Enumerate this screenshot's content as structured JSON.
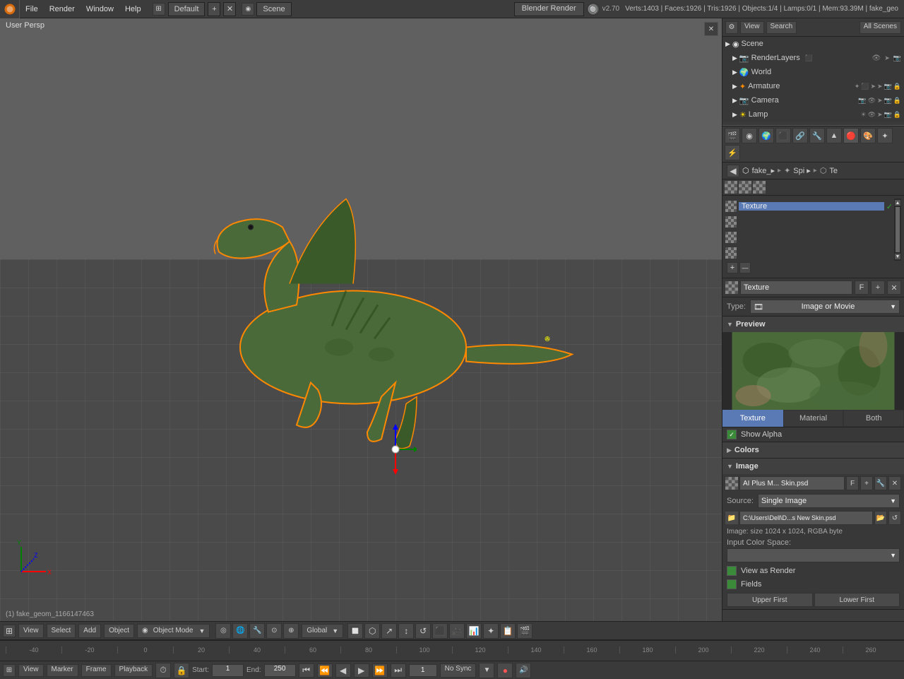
{
  "app": {
    "title": "Blender",
    "version": "v2.70",
    "stats": "Verts:1403 | Faces:1926 | Tris:1926 | Objects:1/4 | Lamps:0/1 | Mem:93.39M | fake_geo",
    "workspace": "Default",
    "scene": "Scene",
    "engine": "Blender Render"
  },
  "menu": {
    "items": [
      "File",
      "Render",
      "Window",
      "Help"
    ]
  },
  "viewport": {
    "mode": "User Persp",
    "object_mode": "Object Mode",
    "transform": "Global",
    "status": "(1) fake_geom_1166147463"
  },
  "outliner": {
    "title": "View",
    "search_label": "Search",
    "all_scenes": "All Scenes",
    "items": [
      {
        "label": "Scene",
        "type": "scene",
        "indent": 0
      },
      {
        "label": "RenderLayers",
        "type": "renderlayers",
        "indent": 1
      },
      {
        "label": "World",
        "type": "world",
        "indent": 1
      },
      {
        "label": "Armature",
        "type": "armature",
        "indent": 1
      },
      {
        "label": "Camera",
        "type": "camera",
        "indent": 1
      },
      {
        "label": "Lamp",
        "type": "lamp",
        "indent": 1
      }
    ]
  },
  "properties": {
    "breadcrumb": {
      "part1": "fake_▸",
      "part2": "Spi ▸",
      "part3": "Te"
    },
    "texture_tabs": [
      "▤",
      "⟳",
      "☀",
      "✦",
      "◎",
      "⬡",
      "🔗",
      "✗",
      "⚡"
    ],
    "texture_type_label": "Type:",
    "texture_type_icon": "🎞",
    "texture_type_value": "Image or Movie",
    "texture_name": "Texture",
    "texture_f_btn": "F",
    "preview_label": "Preview",
    "preview_tabs": [
      "Texture",
      "Material",
      "Both"
    ],
    "show_alpha_label": "Show Alpha",
    "colors_label": "Colors",
    "image_label": "Image",
    "image_file": {
      "name": "AI Plus M... Skin.psd",
      "f_btn": "F",
      "source_label": "Source:",
      "source_value": "Single Image",
      "filepath": "C:\\Users\\Dell\\D...s New Skin.psd",
      "info": "Image: size 1024 x 1024, RGBA byte",
      "input_color_space_label": "Input Color Space:",
      "color_space_value": ""
    },
    "view_as_render_label": "View as Render",
    "fields_label": "Fields",
    "upper_first_btn": "Upper First",
    "lower_first_btn": "Lower First"
  },
  "timeline": {
    "start_label": "Start:",
    "start_value": "1",
    "end_label": "End:",
    "end_value": "250",
    "current_frame": "1",
    "sync": "No Sync",
    "ruler_values": [
      "-40",
      "-20",
      "0",
      "20",
      "40",
      "60",
      "80",
      "100",
      "120",
      "140",
      "160",
      "180",
      "200",
      "220",
      "240",
      "260"
    ]
  },
  "status_bar": {
    "left": "(1) fake_geom_1166147463"
  }
}
